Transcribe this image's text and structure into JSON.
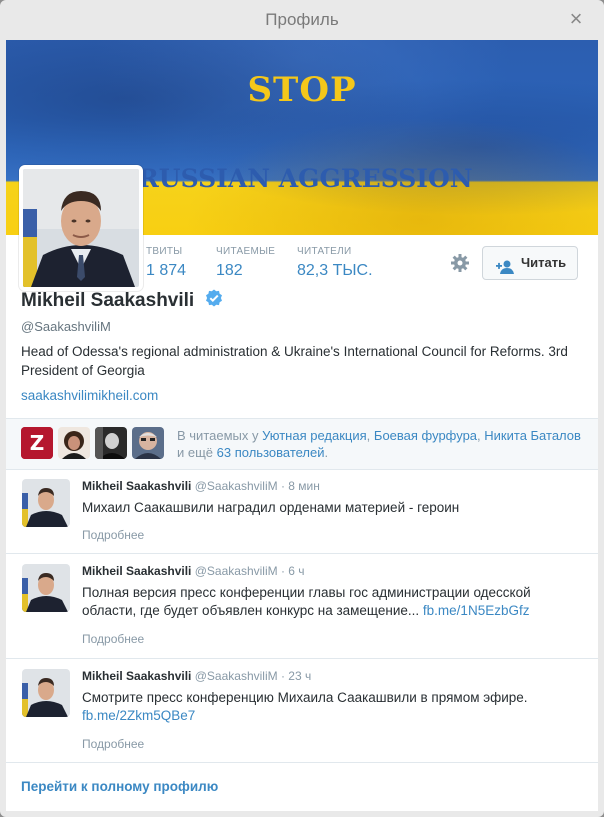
{
  "modal": {
    "title": "Профиль",
    "close_label": "×"
  },
  "banner": {
    "line1": "STOP",
    "line2": "RUSSIAN AGGRESSION"
  },
  "stats": [
    {
      "label": "ТВИТЫ",
      "value": "1 874"
    },
    {
      "label": "ЧИТАЕМЫЕ",
      "value": "182"
    },
    {
      "label": "ЧИТАТЕЛИ",
      "value": "82,3 ТЫС."
    }
  ],
  "follow_button": {
    "label": "Читать"
  },
  "profile": {
    "name": "Mikheil Saakashvili",
    "handle": "@SaakashviliM",
    "bio": "Head of Odessa's regional administration & Ukraine's International Council for Reforms. 3rd President of Georgia",
    "url": "saakashvilimikheil.com"
  },
  "followed_by": {
    "prefix": "В читаемых у ",
    "link1": "Уютная редакция",
    "sep1": ", ",
    "link2": "Боевая фурфура",
    "sep2": ", ",
    "link3": "Никита Баталов",
    "mid": " и ещё ",
    "link4": "63 пользователей",
    "suffix": ".",
    "mini1_letter": "Z"
  },
  "tweets": [
    {
      "name": "Mikheil Saakashvili",
      "handle": "@SaakashviliM",
      "dot": "·",
      "time": "8 мин",
      "text": "Михаил Саакашвили наградил орденами материей - героин",
      "link": "",
      "more": "Подробнее"
    },
    {
      "name": "Mikheil Saakashvili",
      "handle": "@SaakashviliM",
      "dot": "·",
      "time": "6 ч",
      "text": "Полная версия пресс конференции главы гос администрации одесской области, где будет объявлен конкурс на замещение... ",
      "link": "fb.me/1N5EzbGfz",
      "more": "Подробнее"
    },
    {
      "name": "Mikheil Saakashvili",
      "handle": "@SaakashviliM",
      "dot": "·",
      "time": "23 ч",
      "text": "Смотрите пресс конференцию Михаила Саакашвили в прямом эфире. ",
      "link": "fb.me/2Zkm5QBe7",
      "more": "Подробнее"
    }
  ],
  "footer": {
    "link": "Перейти к полному профилю"
  },
  "colors": {
    "link": "#3b88c3",
    "verified": "#55acee",
    "ukraine_blue": "#2c5eb0",
    "ukraine_yellow": "#f6d21a"
  }
}
